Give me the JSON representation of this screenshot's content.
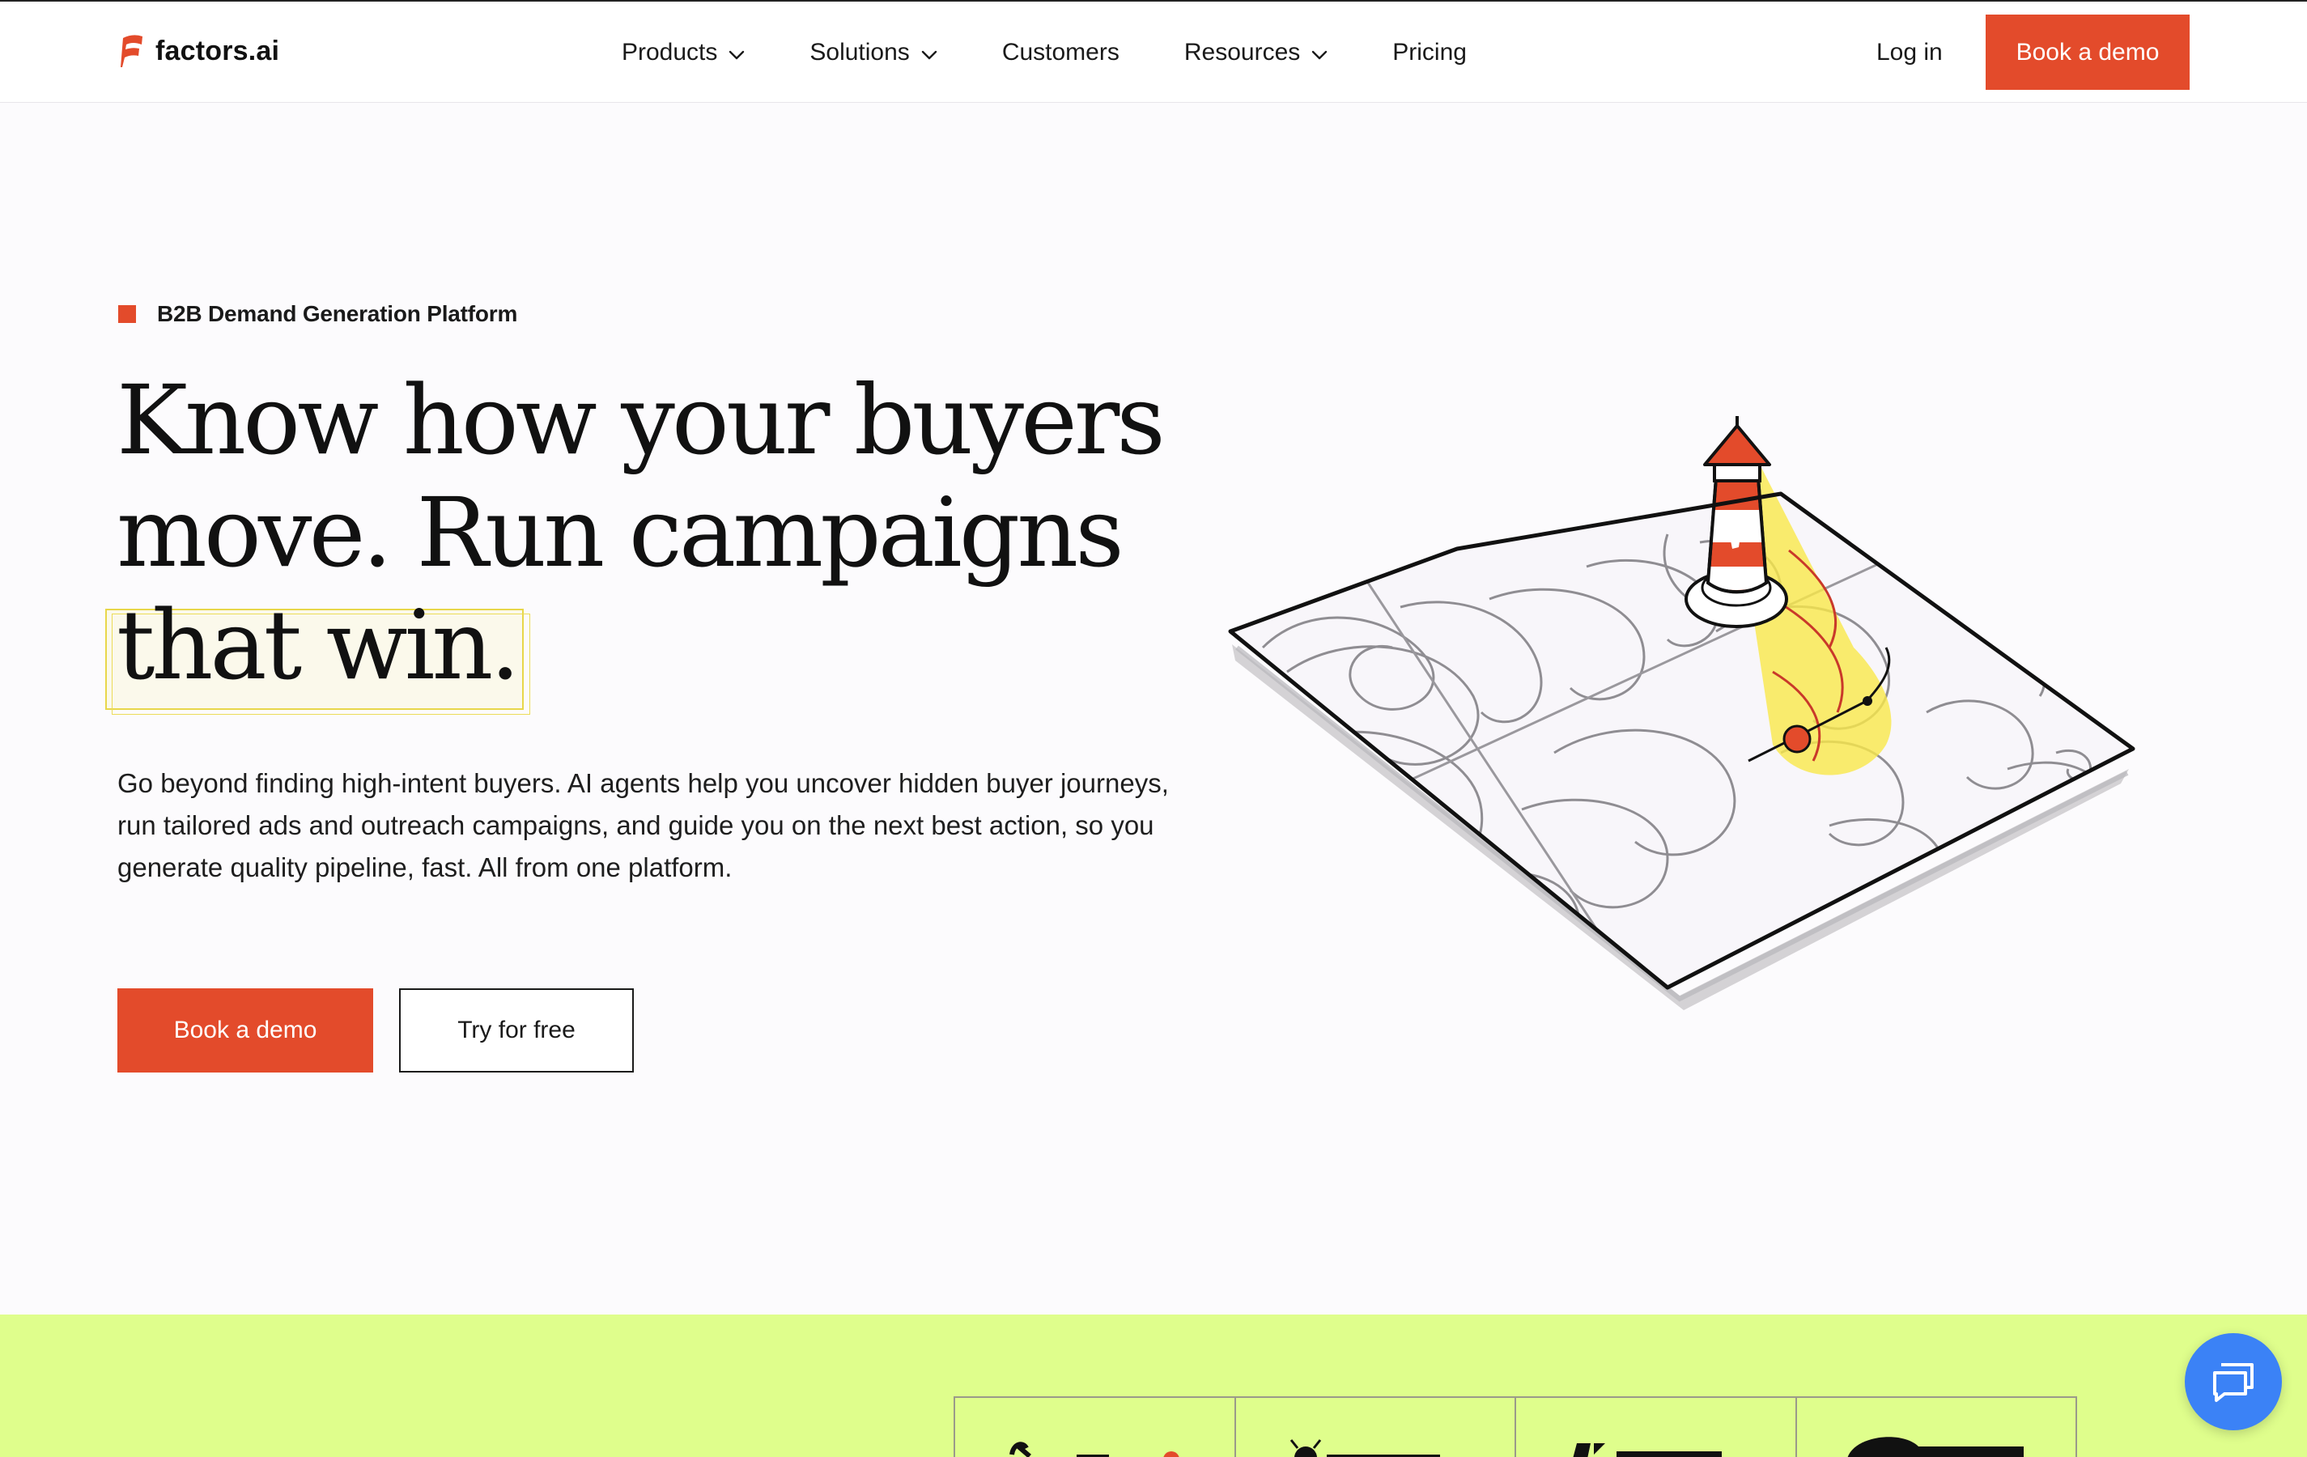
{
  "nav": {
    "logo_text": "factors.ai",
    "items": [
      {
        "label": "Products",
        "has_dropdown": true
      },
      {
        "label": "Solutions",
        "has_dropdown": true
      },
      {
        "label": "Customers",
        "has_dropdown": false
      },
      {
        "label": "Resources",
        "has_dropdown": true
      },
      {
        "label": "Pricing",
        "has_dropdown": false
      }
    ],
    "login": "Log in",
    "cta": "Book a demo"
  },
  "hero": {
    "tag": "B2B Demand Generation Platform",
    "headline": {
      "line1": "Know how your buyers",
      "line2": "move. Run campaigns",
      "line3": "that win."
    },
    "description": "Go beyond finding high-intent buyers. AI agents help you uncover hidden buyer journeys, run tailored ads and outreach campaigns, and guide you on the next best action, so you generate quality pipeline, fast. All from one platform.",
    "primary_button": "Book a demo",
    "secondary_button": "Try for free"
  },
  "colors": {
    "accent": "#e34b2b",
    "band": "#dffe8c",
    "chat": "#3b82f6",
    "highlight": "#f7e65a"
  },
  "icons": {
    "chevron": "chevron-down-icon",
    "chat": "chat-bubble-icon",
    "logo": "factors-flag-icon"
  }
}
